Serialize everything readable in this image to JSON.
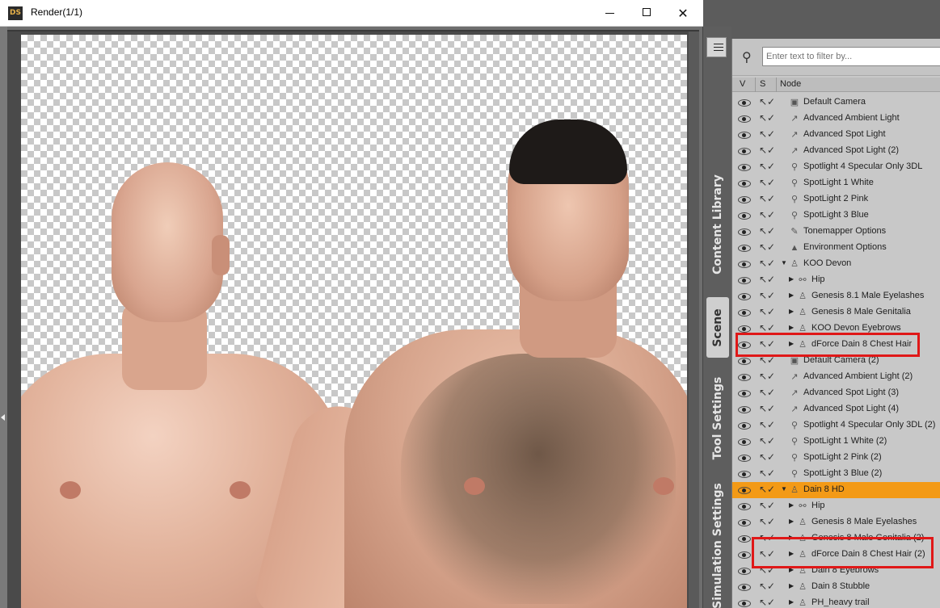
{
  "window": {
    "icon_text": "DS",
    "title": "Render(1/1)",
    "minimize_label": "",
    "maximize_label": "",
    "close_label": "✕"
  },
  "side_tabs": {
    "content_library": "Content Library",
    "scene": "Scene",
    "tool_settings": "Tool Settings",
    "simulation_settings": "Simulation Settings"
  },
  "scene": {
    "filter_placeholder": "Enter text to filter by...",
    "columns": {
      "v": "V",
      "s": "S",
      "node": "Node"
    },
    "rows": [
      {
        "label": "Default Camera",
        "depth": 0,
        "expander": "",
        "icon": "camera-icon",
        "glyph": "▣"
      },
      {
        "label": "Advanced Ambient Light",
        "depth": 0,
        "expander": "",
        "icon": "light-icon",
        "glyph": "↗"
      },
      {
        "label": "Advanced Spot Light",
        "depth": 0,
        "expander": "",
        "icon": "light-icon",
        "glyph": "↗"
      },
      {
        "label": "Advanced Spot Light (2)",
        "depth": 0,
        "expander": "",
        "icon": "light-icon",
        "glyph": "↗"
      },
      {
        "label": "Spotlight 4 Specular Only 3DL",
        "depth": 0,
        "expander": "",
        "icon": "spotlight-icon",
        "glyph": "⚲"
      },
      {
        "label": "SpotLight 1 White",
        "depth": 0,
        "expander": "",
        "icon": "spotlight-icon",
        "glyph": "⚲"
      },
      {
        "label": "SpotLight 2 Pink",
        "depth": 0,
        "expander": "",
        "icon": "spotlight-icon",
        "glyph": "⚲"
      },
      {
        "label": "SpotLight 3 Blue",
        "depth": 0,
        "expander": "",
        "icon": "spotlight-icon",
        "glyph": "⚲"
      },
      {
        "label": "Tonemapper Options",
        "depth": 0,
        "expander": "",
        "icon": "tonemapper-icon",
        "glyph": "✎"
      },
      {
        "label": "Environment Options",
        "depth": 0,
        "expander": "",
        "icon": "environment-icon",
        "glyph": "▲"
      },
      {
        "label": "KOO Devon",
        "depth": 0,
        "expander": "▼",
        "icon": "figure-icon",
        "glyph": "♙"
      },
      {
        "label": "Hip",
        "depth": 1,
        "expander": "▶",
        "icon": "bone-icon",
        "glyph": "⚯"
      },
      {
        "label": "Genesis 8.1 Male Eyelashes",
        "depth": 1,
        "expander": "▶",
        "icon": "figure-icon",
        "glyph": "♙"
      },
      {
        "label": "Genesis 8 Male Genitalia",
        "depth": 1,
        "expander": "▶",
        "icon": "figure-icon",
        "glyph": "♙"
      },
      {
        "label": "KOO Devon Eyebrows",
        "depth": 1,
        "expander": "▶",
        "icon": "figure-icon",
        "glyph": "♙"
      },
      {
        "label": "dForce Dain 8 Chest Hair",
        "depth": 1,
        "expander": "▶",
        "icon": "figure-icon",
        "glyph": "♙"
      },
      {
        "label": "Default Camera (2)",
        "depth": 0,
        "expander": "",
        "icon": "camera-icon",
        "glyph": "▣"
      },
      {
        "label": "Advanced Ambient Light (2)",
        "depth": 0,
        "expander": "",
        "icon": "light-icon",
        "glyph": "↗"
      },
      {
        "label": "Advanced Spot Light (3)",
        "depth": 0,
        "expander": "",
        "icon": "light-icon",
        "glyph": "↗"
      },
      {
        "label": "Advanced Spot Light (4)",
        "depth": 0,
        "expander": "",
        "icon": "light-icon",
        "glyph": "↗"
      },
      {
        "label": "Spotlight 4 Specular Only 3DL (2)",
        "depth": 0,
        "expander": "",
        "icon": "spotlight-icon",
        "glyph": "⚲"
      },
      {
        "label": "SpotLight 1 White (2)",
        "depth": 0,
        "expander": "",
        "icon": "spotlight-icon",
        "glyph": "⚲"
      },
      {
        "label": "SpotLight 2 Pink (2)",
        "depth": 0,
        "expander": "",
        "icon": "spotlight-icon",
        "glyph": "⚲"
      },
      {
        "label": "SpotLight 3 Blue (2)",
        "depth": 0,
        "expander": "",
        "icon": "spotlight-icon",
        "glyph": "⚲"
      },
      {
        "label": "Dain 8 HD",
        "depth": 0,
        "expander": "▼",
        "icon": "figure-icon",
        "glyph": "♙",
        "selected": true
      },
      {
        "label": "Hip",
        "depth": 1,
        "expander": "▶",
        "icon": "bone-icon",
        "glyph": "⚯"
      },
      {
        "label": "Genesis 8 Male Eyelashes",
        "depth": 1,
        "expander": "▶",
        "icon": "figure-icon",
        "glyph": "♙"
      },
      {
        "label": "Genesis 8 Male Genitalia (2)",
        "depth": 1,
        "expander": "▶",
        "icon": "figure-icon",
        "glyph": "♙"
      },
      {
        "label": "dForce Dain 8 Chest Hair (2)",
        "depth": 1,
        "expander": "▶",
        "icon": "figure-icon",
        "glyph": "♙"
      },
      {
        "label": "Dain 8 Eyebrows",
        "depth": 1,
        "expander": "▶",
        "icon": "figure-icon",
        "glyph": "♙"
      },
      {
        "label": "Dain 8 Stubble",
        "depth": 1,
        "expander": "▶",
        "icon": "figure-icon",
        "glyph": "♙"
      },
      {
        "label": "PH_heavy trail",
        "depth": 1,
        "expander": "▶",
        "icon": "figure-icon",
        "glyph": "♙"
      }
    ]
  },
  "colors": {
    "selection": "#f39a16",
    "annotation": "#e01818",
    "panel_bg": "#c8c8c8"
  }
}
